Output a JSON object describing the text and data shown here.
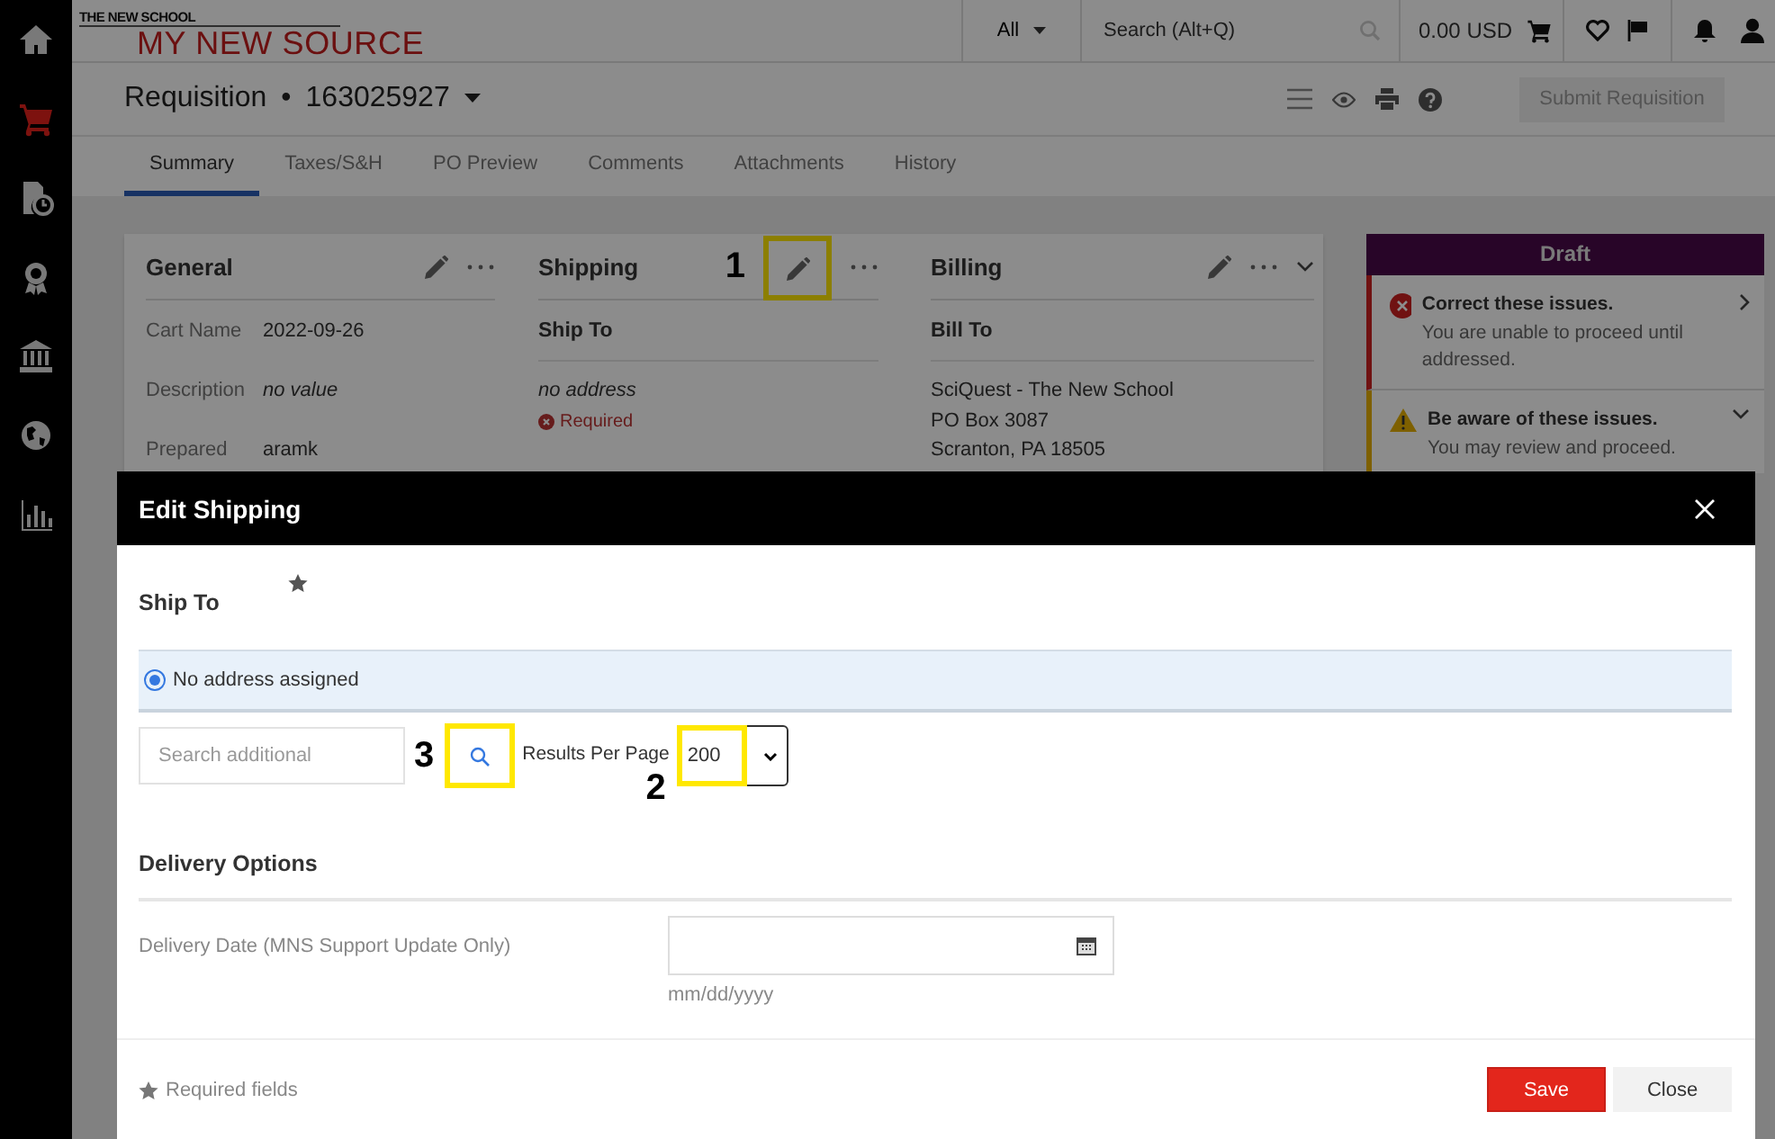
{
  "sidebar": {
    "items": [
      {
        "selected": false
      },
      {
        "selected": true
      },
      {
        "selected": false
      },
      {
        "selected": false
      },
      {
        "selected": false
      },
      {
        "selected": false
      },
      {
        "selected": false
      }
    ]
  },
  "top_bar": {
    "logo": {
      "small": "THE NEW SCHOOL",
      "large": "MY NEW SOURCE"
    },
    "search_scope": "All",
    "search": {
      "placeholder": "Search (Alt+Q)"
    },
    "cart_total": "0.00 USD"
  },
  "header": {
    "title": "Requisition",
    "separator": "•",
    "number": "163025927",
    "submit_button": {
      "label": "Submit Requisition",
      "disabled": true
    }
  },
  "tabs": [
    {
      "label": "Summary",
      "selected": true
    },
    {
      "label": "Taxes/S&H",
      "selected": false
    },
    {
      "label": "PO Preview",
      "selected": false
    },
    {
      "label": "Comments",
      "selected": false
    },
    {
      "label": "Attachments",
      "selected": false
    },
    {
      "label": "History",
      "selected": false
    }
  ],
  "general": {
    "title": "General",
    "fields": [
      {
        "label": "Cart Name",
        "value": "2022-09-26",
        "empty": false
      },
      {
        "label": "Description",
        "value": "no value",
        "empty": true
      },
      {
        "label": "Prepared",
        "value": "aramk",
        "empty": false
      }
    ]
  },
  "shipping": {
    "title": "Shipping",
    "step_marker": "1",
    "edit_highlighted": true,
    "subheading": "Ship To",
    "address": "no address",
    "error": "Required"
  },
  "billing": {
    "title": "Billing",
    "subheading": "Bill To",
    "lines": [
      "SciQuest - The New School",
      "PO Box 3087",
      "Scranton, PA 18505"
    ]
  },
  "draft": {
    "title": "Draft",
    "issues": [
      {
        "kind": "error",
        "title": "Correct these issues.",
        "text": "You are unable to proceed until addressed."
      },
      {
        "kind": "warning",
        "title": "Be aware of these issues.",
        "text": "You may review and proceed."
      }
    ]
  },
  "modal": {
    "title": "Edit Shipping",
    "ship_to": {
      "label": "Ship To",
      "required": true
    },
    "address_options": [
      {
        "label": "No address assigned",
        "selected": true
      }
    ],
    "search": {
      "placeholder": "Search additional",
      "step_marker": "3",
      "highlighted": true
    },
    "results_per_page": {
      "label": "Results Per Page",
      "value": "200",
      "step_marker": "2",
      "highlighted": true
    },
    "delivery": {
      "heading": "Delivery Options",
      "date_label": "Delivery Date (MNS Support Update Only)",
      "date_hint": "mm/dd/yyyy"
    },
    "footer": {
      "required_note": "Required fields",
      "save": "Save",
      "close": "Close"
    }
  }
}
